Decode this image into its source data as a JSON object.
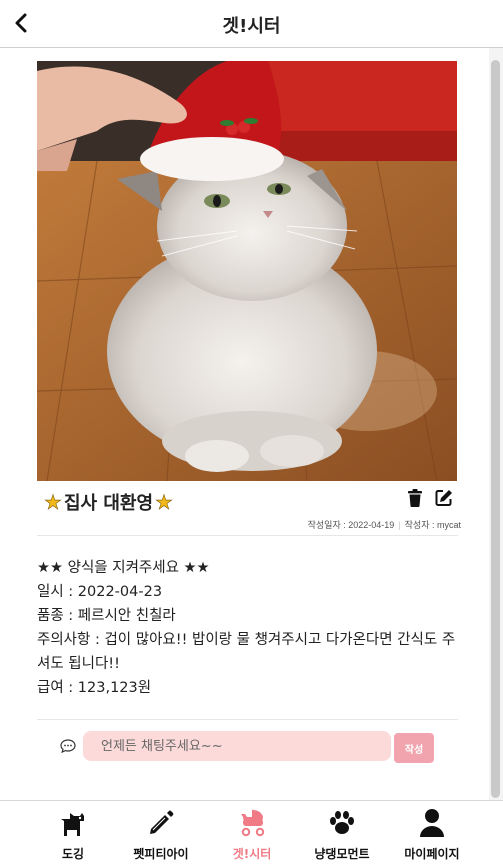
{
  "header": {
    "title": "겟!시터",
    "back_icon": "chevron-left-icon"
  },
  "post": {
    "photo_alt": "white persian chinchilla cat wearing a red santa hat",
    "title": "집사 대환영",
    "title_star_left": "★",
    "title_star_right": "★",
    "actions": {
      "delete_icon": "trash-icon",
      "edit_icon": "edit-icon"
    },
    "meta": {
      "date_label": "작성일자 : 2022-04-19",
      "author_label": "작성자 : mycat"
    },
    "body_lines": [
      "★★ 양식을 지켜주세요 ★★",
      "일시 : 2022-04-23",
      "품종 : 페르시안 친칠라",
      "주의사항 : 겁이 많아요!! 밥이랑 물 챙겨주시고 다가온다면 간식도 주셔도 됩니다!!",
      "급여 : 123,123원"
    ]
  },
  "chat": {
    "icon": "comment-icon",
    "placeholder": "언제든 채팅주세요~~",
    "submit_label": "작성"
  },
  "nav": {
    "active": "겟!시터",
    "items": [
      {
        "label": "도깅",
        "icon": "dog-icon"
      },
      {
        "label": "펫피티아이",
        "icon": "pencil-icon"
      },
      {
        "label": "겟!시터",
        "icon": "baby-carriage-icon"
      },
      {
        "label": "냥댕모먼트",
        "icon": "paw-icon"
      },
      {
        "label": "마이페이지",
        "icon": "user-icon"
      }
    ]
  },
  "colors": {
    "accent": "#f07a86",
    "chat_input_bg": "#fcdada",
    "submit_bg": "#f1a4ae",
    "star": "#f3b91a"
  }
}
